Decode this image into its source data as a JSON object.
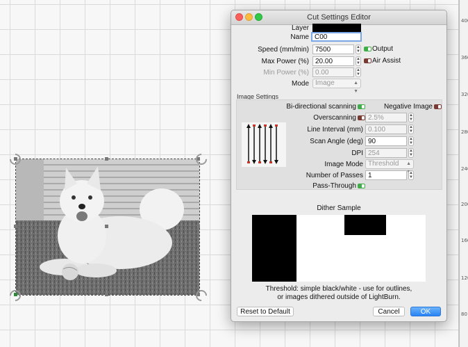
{
  "window": {
    "title": "Cut Settings Editor"
  },
  "fields": {
    "layer_label": "Layer",
    "name_label": "Name",
    "name_value": "C00",
    "speed_label": "Speed (mm/min)",
    "speed_value": "7500",
    "output_label": "Output",
    "max_power_label": "Max Power (%)",
    "max_power_value": "20.00",
    "air_assist_label": "Air Assist",
    "min_power_label": "Min Power (%)",
    "min_power_value": "0.00",
    "mode_label": "Mode",
    "mode_value": "Image"
  },
  "image_settings": {
    "section_title": "Image Settings",
    "bidirectional_label": "Bi-directional scanning",
    "negative_label": "Negative Image",
    "overscanning_label": "Overscanning",
    "overscanning_value": "2.5%",
    "line_interval_label": "Line Interval (mm)",
    "line_interval_value": "0.100",
    "scan_angle_label": "Scan Angle (deg)",
    "scan_angle_value": "90",
    "dpi_label": "DPI",
    "dpi_value": "254",
    "image_mode_label": "Image Mode",
    "image_mode_value": "Threshold",
    "passes_label": "Number of Passes",
    "passes_value": "1",
    "pass_through_label": "Pass-Through"
  },
  "dither": {
    "title": "Dither Sample",
    "desc_line1": "Threshold: simple black/white - use for outlines,",
    "desc_line2": "or images dithered outside of LightBurn."
  },
  "buttons": {
    "reset": "Reset to Default",
    "cancel": "Cancel",
    "ok": "OK"
  },
  "ruler_ticks": [
    "400",
    "360",
    "320",
    "280",
    "240",
    "200",
    "160",
    "120",
    "80"
  ],
  "colors": {
    "toggle_on": "#3fae48",
    "toggle_off": "#7a3a32",
    "ok_button": "#2883f5"
  }
}
